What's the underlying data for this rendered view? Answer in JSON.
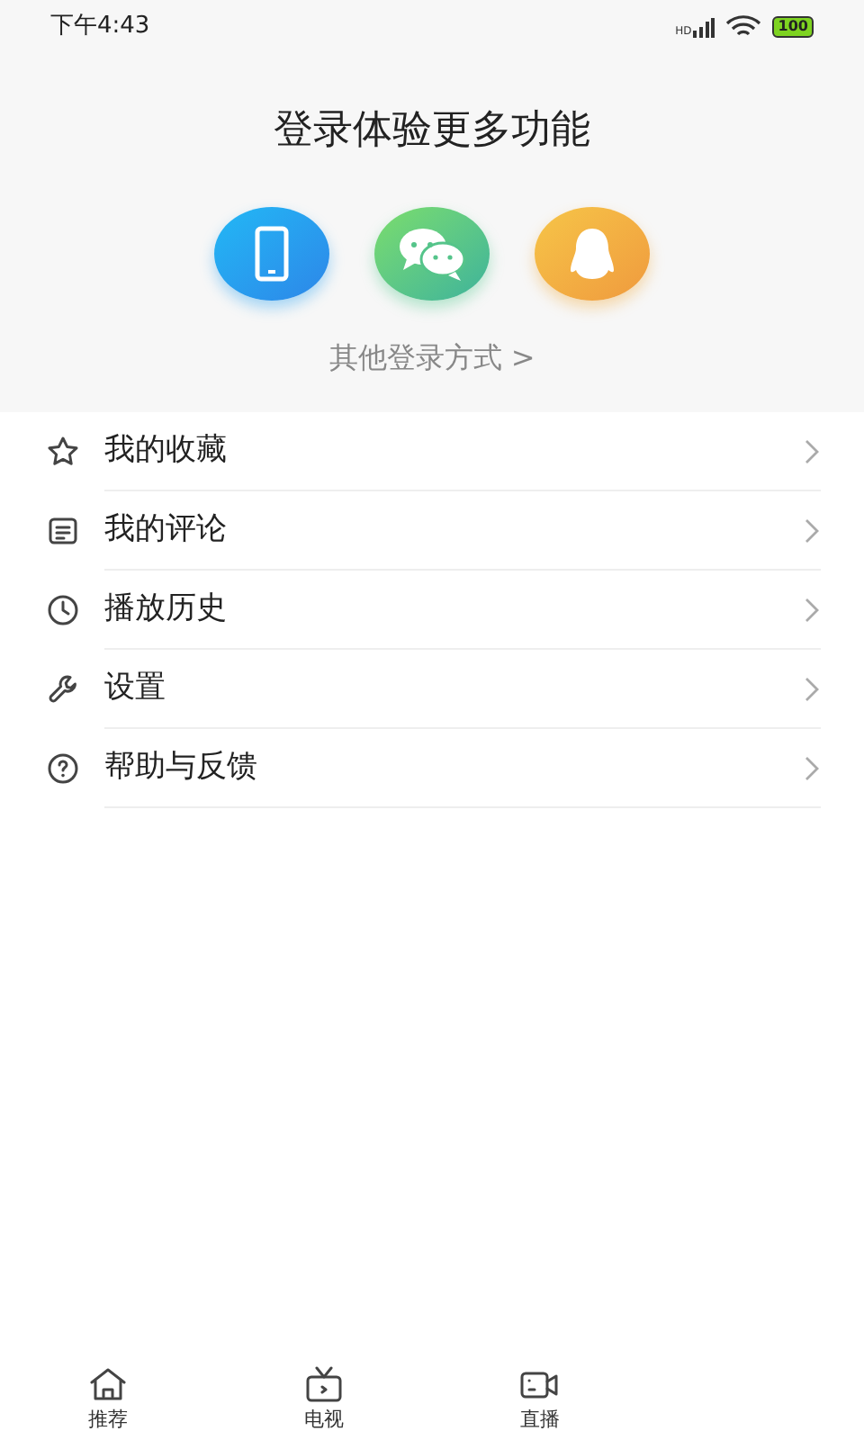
{
  "status_bar": {
    "time": "下午4:43",
    "battery": "100",
    "network": "HD"
  },
  "login": {
    "title": "登录体验更多功能",
    "methods": [
      {
        "kind": "phone"
      },
      {
        "kind": "wechat"
      },
      {
        "kind": "qq"
      }
    ],
    "other": "其他登录方式 >"
  },
  "menu": [
    {
      "label": "我的收藏",
      "kind": "star"
    },
    {
      "label": "我的评论",
      "kind": "comment"
    },
    {
      "label": "播放历史",
      "kind": "clock"
    },
    {
      "label": "设置",
      "kind": "wrench"
    },
    {
      "label": "帮助与反馈",
      "kind": "help"
    }
  ],
  "tab_bar": [
    {
      "label": "推荐",
      "kind": "home"
    },
    {
      "label": "电视",
      "kind": "tv"
    },
    {
      "label": "直播",
      "kind": "camera"
    }
  ]
}
